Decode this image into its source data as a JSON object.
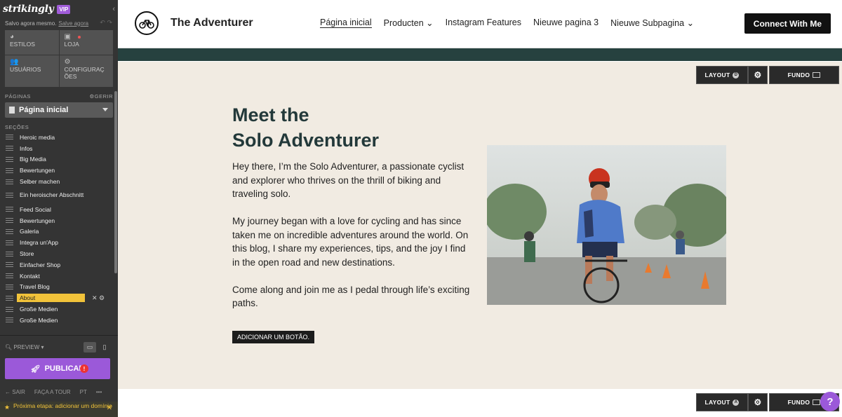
{
  "editor": {
    "brand": "strikingly",
    "vip": "VIP",
    "saved_text": "Salvo agora mesmo.",
    "saved_link": "Salve agora",
    "tools": {
      "styles": "ESTILOS",
      "store": "LOJA",
      "users": "USUÁRIOS",
      "settings": "CONFIGURAÇ ÕES"
    },
    "pages_label": "PÁGINAS",
    "manage_label": "GERIR",
    "current_page": "Página inicial",
    "sections_label": "SEÇÕES",
    "sections": [
      "Heroic media",
      "Infos",
      "Big Media",
      "Bewertungen",
      "Selber machen",
      "Ein heroischer Abschnitt",
      "Feed Social",
      "Bewertungen",
      "Galeria",
      "Integra un'App",
      "Store",
      "Einfacher Shop",
      "Kontakt",
      "Travel Blog",
      "About",
      "Große Medien",
      "Große Medien"
    ],
    "active_section": "About",
    "preview": "PREVIEW",
    "publish": "PUBLICAR",
    "exit": "SAIR",
    "tour": "FAÇA A TOUR",
    "lang": "PT",
    "more": "•••",
    "next_step": "Próxima etapa: adicionar um domínio"
  },
  "site": {
    "title": "The Adventurer",
    "nav": [
      "Página inicial",
      "Producten",
      "Instagram Features",
      "Nieuwe pagina 3",
      "Nieuwe Subpagina"
    ],
    "cta": "Connect With Me"
  },
  "controls": {
    "layout": "LAYOUT",
    "layout_badge_1": "D",
    "layout_badge_2": "A",
    "background": "FUNDO"
  },
  "about": {
    "heading_line1": "Meet the",
    "heading_line2": "Solo Adventurer",
    "p1": "Hey there, I’m the Solo Adventurer, a passionate cyclist and explorer who thrives on the thrill of biking and traveling solo.",
    "p2": "My journey began with a love for cycling and has since taken me on incredible adventures around the world. On this blog, I share my experiences, tips, and the joy I find in the open road and new destinations.",
    "p3": "Come along and join me as I pedal through life’s exciting paths.",
    "add_button": "ADICIONAR UM BOTÃO."
  },
  "help": "?",
  "colors": {
    "accent": "#9b59d9",
    "dark_green": "#26413f",
    "section_bg": "#f1ebe2",
    "highlight": "#f2c33a"
  }
}
